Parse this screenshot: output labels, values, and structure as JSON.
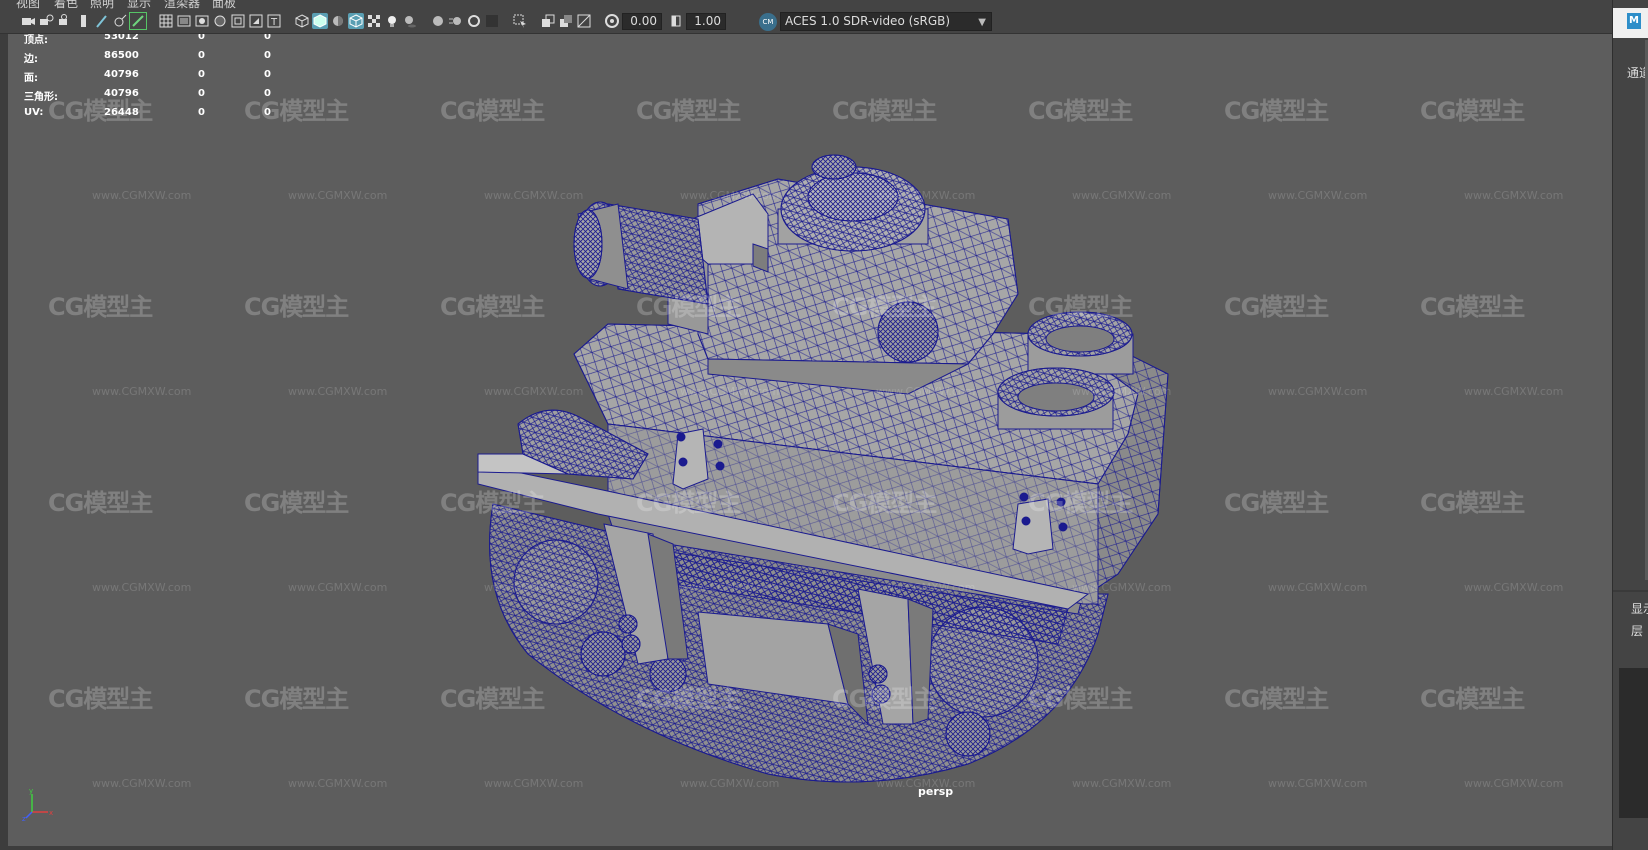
{
  "menu": [
    "视图",
    "着色",
    "照明",
    "显示",
    "渲染器",
    "面板"
  ],
  "toolbar": {
    "exposure_value": "0.00",
    "gamma_value": "1.00",
    "color_space": "ACES 1.0 SDR-video (sRGB)",
    "color_space_icon_text": "CM"
  },
  "hud": {
    "rows": [
      {
        "label": "顶点:",
        "v1": "53012",
        "v2": "0",
        "v3": "0"
      },
      {
        "label": "边:",
        "v1": "86500",
        "v2": "0",
        "v3": "0"
      },
      {
        "label": "面:",
        "v1": "40796",
        "v2": "0",
        "v3": "0"
      },
      {
        "label": "三角形:",
        "v1": "40796",
        "v2": "0",
        "v3": "0"
      },
      {
        "label": "UV:",
        "v1": "26448",
        "v2": "0",
        "v3": "0"
      }
    ]
  },
  "viewport": {
    "camera_label": "persp",
    "watermark_logo": "CG模型主",
    "watermark_url": "www.CGMXW.com",
    "axis_labels": {
      "x": "x",
      "y": "y",
      "z": "z"
    }
  },
  "right_panel": {
    "logo_text": "M",
    "channel_tab": "通道",
    "display_tab": "显示",
    "layer_tab": "层"
  },
  "colors": {
    "viewport_bg": "#5d5d5d",
    "wireframe": "#1b1b8f",
    "mesh_fill": "#9a9a9a",
    "hud_text": "#ffffff",
    "active_tool": "#5a9fb3"
  }
}
